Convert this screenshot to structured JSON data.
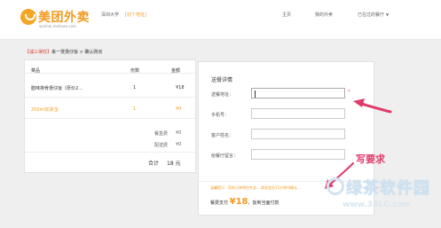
{
  "header": {
    "logo_text": "美团外卖",
    "logo_sub": "waimai.meituan.com",
    "city": "深圳大学",
    "switch_link": "[切个地址]",
    "nav": {
      "home": "主页",
      "mine": "我的外卖",
      "new": "已在过的餐厅",
      "new_chevron": "▼"
    }
  },
  "breadcrumb": {
    "tag": "【减三得饮】",
    "shop": "来一煲煲仔饭",
    "sep": " > ",
    "page": "确认购买"
  },
  "order": {
    "headers": {
      "item": "菜品",
      "qty": "份数",
      "amount": "金额"
    },
    "rows": [
      {
        "name": "腊味排骨煲仔饭（厚价2...",
        "qty": "1",
        "amount": "¥18",
        "color": "#333333"
      },
      {
        "name": "250ml加多宝",
        "qty": "1",
        "amount": "¥0",
        "color": "#f29b1f"
      }
    ],
    "fees": {
      "box_label": "餐盒费",
      "box_value": "¥0",
      "delivery_label": "配送费",
      "delivery_value": "¥0"
    },
    "total": {
      "label": "合计",
      "value": "18 元"
    }
  },
  "form": {
    "title": "送餐详情",
    "fields": [
      {
        "label": "送餐地址：",
        "value": ""
      },
      {
        "label": "手机号：",
        "value": ""
      },
      {
        "label": "客户姓名：",
        "value": ""
      },
      {
        "label": "给餐厅留言：",
        "value": ""
      }
    ],
    "required_mark": "*",
    "notice": "温馨提示：您的订单将在外卖... 商家会在11分钟内确认...",
    "pay_label": "餐费支付",
    "pay_amount": "¥18",
    "pay_method": "，饭到当面付款"
  },
  "annotation": {
    "text": "写要求",
    "color": "#e03a6a"
  },
  "watermark": {
    "title": "绿茶软件园",
    "url": "www.33LC.com"
  },
  "colors": {
    "brand": "#f29b1f",
    "accent_red": "#e03a2e"
  }
}
